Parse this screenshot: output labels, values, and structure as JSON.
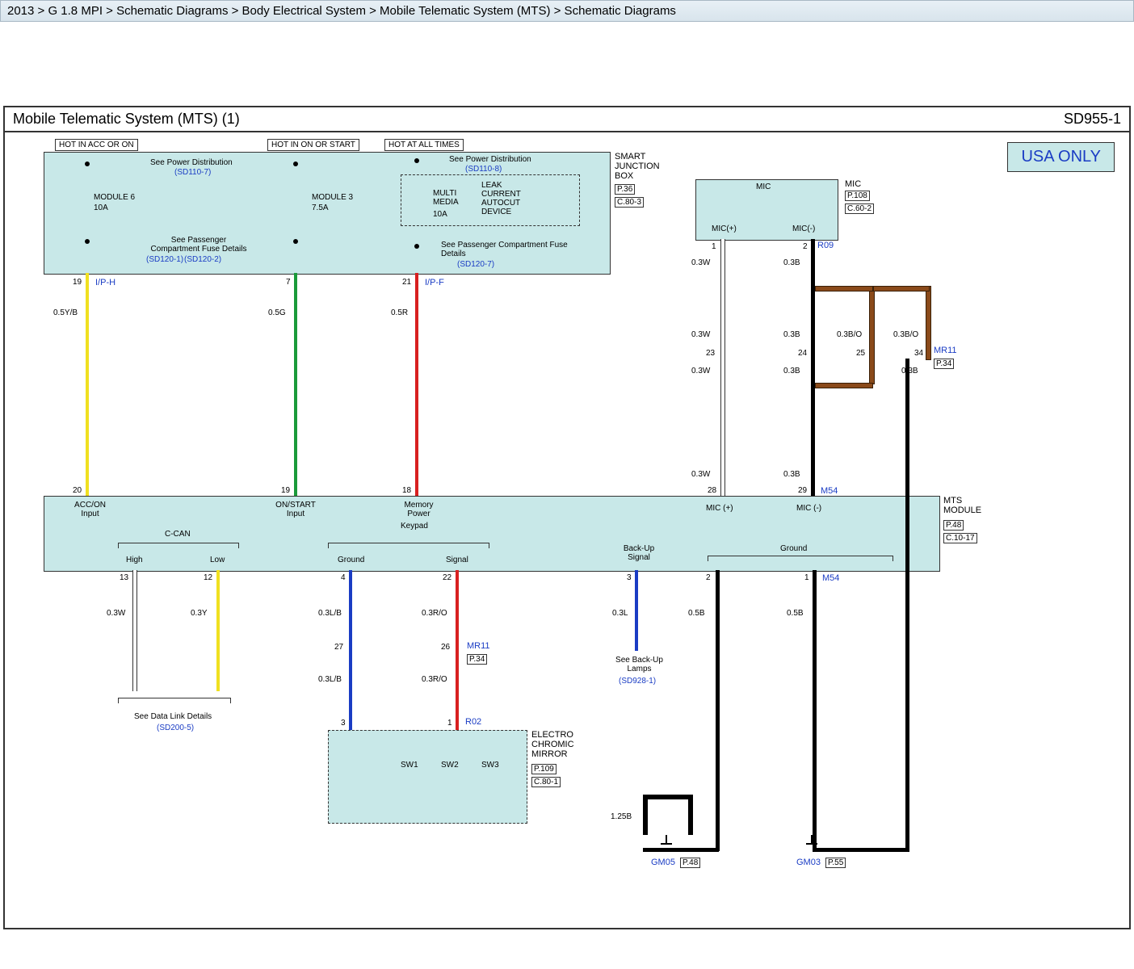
{
  "breadcrumb": "2013 > G 1.8 MPI > Schematic Diagrams > Body Electrical System > Mobile Telematic System (MTS) > Schematic Diagrams",
  "title": "Mobile Telematic System (MTS) (1)",
  "diagram_id": "SD955-1",
  "region_badge": "USA ONLY",
  "hot_labels": {
    "acc": "HOT IN ACC OR ON",
    "on": "HOT IN ON OR START",
    "all": "HOT AT ALL TIMES"
  },
  "sjb": {
    "name": "SMART JUNCTION BOX",
    "page": "P.36",
    "cref": "C.80-3",
    "pwr_dist": "See Power Distribution",
    "sd1107": "(SD110-7)",
    "sd1108": "(SD110-8)",
    "mod6": "MODULE 6",
    "mod6_rating": "10A",
    "mod3": "MODULE 3",
    "mod3_rating": "7.5A",
    "mm": "MULTI MEDIA",
    "mm_rating": "10A",
    "leak": "LEAK CURRENT AUTOCUT DEVICE",
    "fuse_det": "See Passenger Compartment Fuse Details",
    "sd1201": "(SD120-1)",
    "sd1202": "(SD120-2)",
    "sd1207": "(SD120-7)"
  },
  "mic": {
    "name": "MIC",
    "page": "P.108",
    "cref": "C.60-2",
    "pos": "MIC(+)",
    "neg": "MIC(-)",
    "sym": "MIC"
  },
  "mts": {
    "name": "MTS MODULE",
    "page": "P.48",
    "cref": "C.10-17",
    "inputs": {
      "acc": "ACC/ON Input",
      "on": "ON/START Input",
      "mem": "Memory Power",
      "micp": "MIC (+)",
      "micn": "MIC (-)"
    },
    "outputs": {
      "ccan": "C-CAN",
      "high": "High",
      "low": "Low",
      "kp": "Keypad",
      "gnd": "Ground",
      "sig": "Signal",
      "bu": "Back-Up Signal",
      "ground2": "Ground"
    }
  },
  "wires": {
    "w1": "0.5Y/B",
    "w2": "0.5G",
    "w3": "0.5R",
    "m1": "0.3W",
    "m2": "0.3B",
    "m3": "0.3B/O",
    "m4": "0.3B/O",
    "m5": "0.3B",
    "c1": "0.3W",
    "c2": "0.3Y",
    "k1": "0.3L/B",
    "k2": "0.3R/O",
    "k3": "0.3L/B",
    "k4": "0.3R/O",
    "bu": "0.3L",
    "g1": "0.5B",
    "g2": "0.5B",
    "g3": "1.25B"
  },
  "pins": {
    "p19": "19",
    "p7": "7",
    "p21": "21",
    "p20": "20",
    "p19b": "19",
    "p18": "18",
    "p28": "28",
    "p29": "29",
    "p13": "13",
    "p12": "12",
    "p4": "4",
    "p22": "22",
    "p3": "3",
    "p2": "2",
    "p1": "1",
    "p27": "27",
    "p26": "26",
    "k3": "3",
    "k1": "1",
    "m1": "1",
    "m2": "2",
    "p23": "23",
    "p24": "24",
    "p25": "25",
    "p34": "34"
  },
  "conns": {
    "iph": "I/P-H",
    "ipf": "I/P-F",
    "r09": "R09",
    "mr11": "MR11",
    "p34": "P.34",
    "m54": "M54",
    "r02": "R02",
    "gm05": "GM05",
    "p48": "P.48",
    "gm03": "GM03",
    "p55": "P.55"
  },
  "refs": {
    "datalink": "See Data Link Details",
    "sd2005": "(SD200-5)",
    "backup": "See Back-Up Lamps",
    "sd9281": "(SD928-1)"
  },
  "ecm": {
    "name": "ELECTRO CHROMIC MIRROR",
    "page": "P.109",
    "cref": "C.80-1",
    "sw1": "SW1",
    "sw2": "SW2",
    "sw3": "SW3"
  }
}
